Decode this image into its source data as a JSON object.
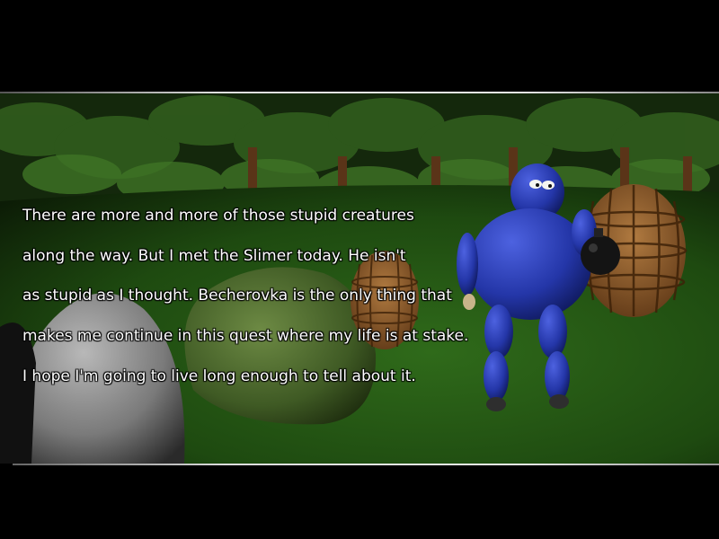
{
  "scene": {
    "description_icons": [
      "palm-tree",
      "rock",
      "mossy-boulder",
      "wooden-barrel",
      "blue-creature",
      "bomb"
    ],
    "colors": {
      "grass": "#1f4a12",
      "foliage": "#2f5a1c",
      "rock_gray": "#8c8c8c",
      "boulder_green": "#4f6a30",
      "barrel": "#8a5a2c",
      "creature_blue": "#2436a8"
    }
  },
  "narration": {
    "lines": [
      "There are more and more of those stupid creatures",
      "along the way. But I met the Slimer today. He isn't",
      "as stupid as I thought. Becherovka is the only thing that",
      "makes me continue in this quest where my life is at stake.",
      "I hope I'm going to live long enough to tell about it."
    ]
  }
}
